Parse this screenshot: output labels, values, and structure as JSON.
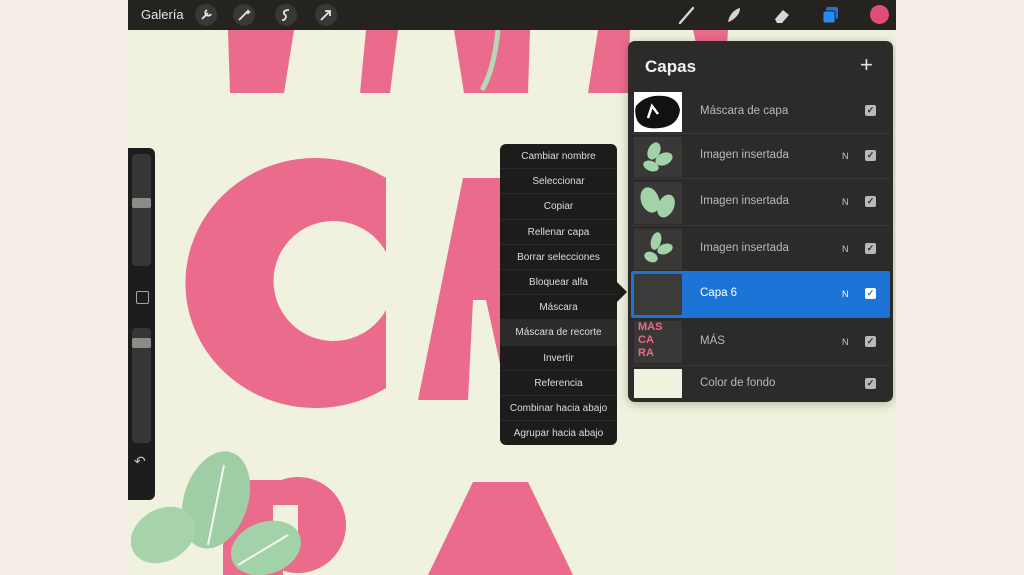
{
  "topbar": {
    "gallery_label": "Galería",
    "tools": [
      "wrench-icon",
      "magic-wand-icon",
      "selection-icon",
      "transform-arrow-icon"
    ],
    "right_tools": [
      "brush-icon",
      "smudge-icon",
      "eraser-icon",
      "layers-icon"
    ],
    "current_color": "#e04e73"
  },
  "canvas": {
    "text_lines": [
      "MÁS",
      "CA",
      "RA"
    ],
    "text_color": "#ea6b8c",
    "background_color": "#f0f1de"
  },
  "context_menu": {
    "items": [
      "Cambiar nombre",
      "Seleccionar",
      "Copiar",
      "Rellenar capa",
      "Borrar selecciones",
      "Bloquear alfa",
      "Máscara",
      "Máscara de recorte",
      "Invertir",
      "Referencia",
      "Combinar hacia abajo",
      "Agrupar hacia abajo"
    ]
  },
  "layers_panel": {
    "title": "Capas",
    "add_icon": "plus-icon",
    "layers": [
      {
        "name": "Máscara de capa",
        "blend": "",
        "visible": true
      },
      {
        "name": "Imagen insertada",
        "blend": "N",
        "visible": true
      },
      {
        "name": "Imagen insertada",
        "blend": "N",
        "visible": true
      },
      {
        "name": "Imagen insertada",
        "blend": "N",
        "visible": true
      },
      {
        "name": "Capa 6",
        "blend": "N",
        "visible": true,
        "selected": true
      },
      {
        "name": "MÁS",
        "blend": "N",
        "visible": true,
        "thumb_text": [
          "MÁS",
          "CA",
          "RA"
        ]
      },
      {
        "name": "Color de fondo",
        "blend": "",
        "visible": true
      }
    ]
  }
}
